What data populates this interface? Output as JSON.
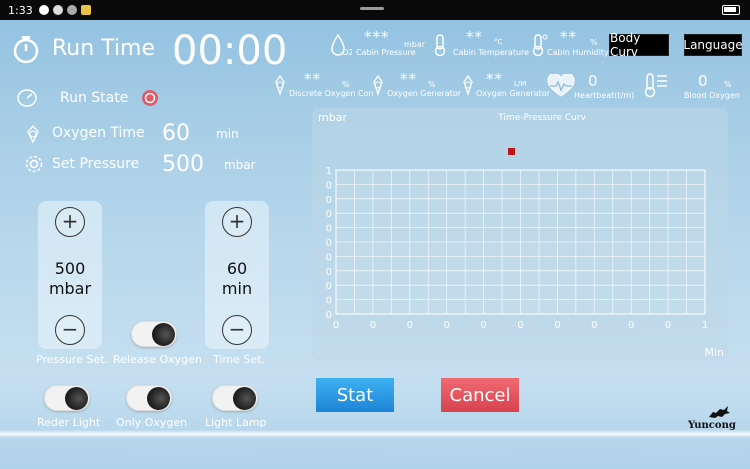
{
  "status_bar": {
    "time": "1:33"
  },
  "header": {
    "run_time_label": "Run Time",
    "run_time_value": "00:00",
    "body_curv_button": "Body Curv",
    "language_button": "Language"
  },
  "stats_row1": [
    {
      "value": "***",
      "unit": "mbar",
      "label": "Cabin Pressure",
      "icon": "o2-drop-icon"
    },
    {
      "value": "**",
      "unit": "°C",
      "label": "Cabin Temperature",
      "icon": "thermometer-icon"
    },
    {
      "value": "**",
      "unit": "%",
      "label": "Cabin Humidity",
      "icon": "humidity-thermometer-icon"
    }
  ],
  "stats_row2": [
    {
      "value": "**",
      "unit": "%",
      "label": "Discrete Oxygen Con",
      "icon": "oxygen-concentration-icon"
    },
    {
      "value": "**",
      "unit": "%",
      "label": "Oxygen Generator",
      "icon": "oxygen-generator-icon"
    },
    {
      "value": "**",
      "unit": "L/M",
      "label": "Oxygen Generator",
      "icon": "oxygen-flow-icon"
    },
    {
      "value": "0",
      "unit": "",
      "label": "Heartbeat(t/m)",
      "icon": "heartbeat-icon"
    },
    {
      "value": "0",
      "unit": "%",
      "label": "Blood Oxygen",
      "icon": "blood-oxygen-icon"
    }
  ],
  "left": {
    "run_state_label": "Run State",
    "oxygen_time_label": "Oxygen Time",
    "oxygen_time_value": "60",
    "oxygen_time_unit": "min",
    "set_pressure_label": "Set Pressure",
    "set_pressure_value": "500",
    "set_pressure_unit": "mbar"
  },
  "pressure_panel": {
    "plus": "+",
    "minus": "−",
    "value": "500",
    "unit": "mbar",
    "label": "Pressure Set."
  },
  "time_panel": {
    "plus": "+",
    "minus": "−",
    "value": "60",
    "unit": "min",
    "label": "Time Set."
  },
  "toggles": {
    "release_oxygen": "Release Oxygen",
    "reder_light": "Reder Light",
    "only_oxygen": "Only Oxygen",
    "light_lamp": "Light Lamp"
  },
  "buttons": {
    "stat": "Stat",
    "cancel": "Cancel"
  },
  "brand": {
    "name": "Yuncong"
  },
  "colors": {
    "stat_blue": "#2a9ae6",
    "cancel_red": "#e25560",
    "series_marker": "#c0141c"
  },
  "chart_data": {
    "type": "line",
    "title": "Time-Pressure Curv",
    "ylabel": "mbar",
    "xlabel": "Min",
    "x_tick_labels": [
      "0",
      "0",
      "0",
      "0",
      "0",
      "0",
      "0",
      "0",
      "0",
      "0",
      "1"
    ],
    "y_tick_labels": [
      "0",
      "0",
      "0",
      "0",
      "0",
      "0",
      "0",
      "0",
      "0",
      "0",
      "1"
    ],
    "x": [],
    "values": [],
    "grid": true,
    "legend": "top-center"
  }
}
